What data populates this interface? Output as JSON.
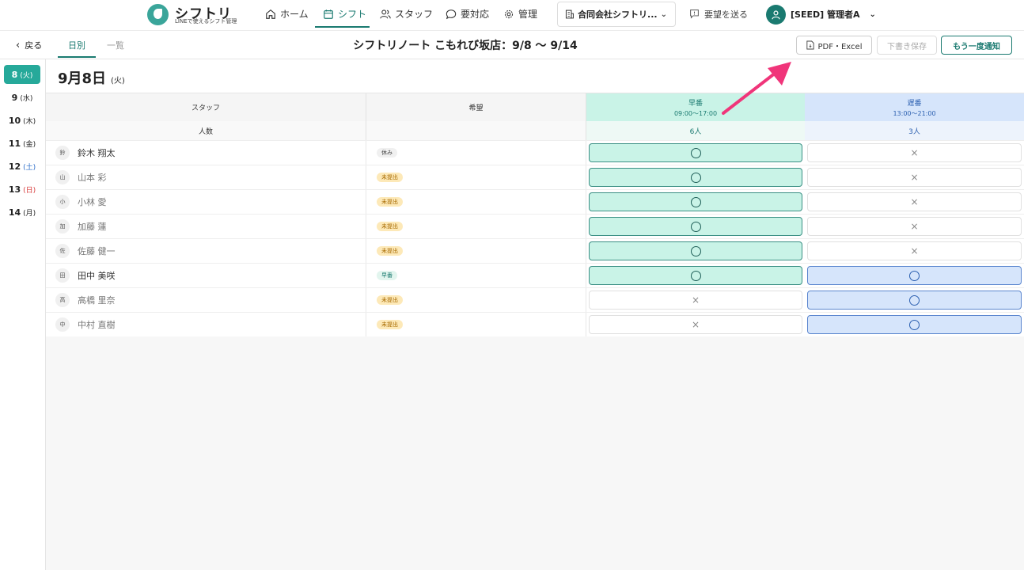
{
  "brand": {
    "name": "シフトリ",
    "tagline": "LINEで使えるシフト管理"
  },
  "nav": {
    "items": [
      {
        "label": "ホーム",
        "icon": "home-icon"
      },
      {
        "label": "シフト",
        "icon": "calendar-icon",
        "active": true
      },
      {
        "label": "スタッフ",
        "icon": "users-icon"
      },
      {
        "label": "要対応",
        "icon": "chat-icon"
      },
      {
        "label": "管理",
        "icon": "gear-icon"
      }
    ],
    "company": "合同会社シフトリ...",
    "feedback": "要望を送る",
    "user": "[SEED] 管理者A"
  },
  "subbar": {
    "back": "戻る",
    "tabs": [
      {
        "label": "日別",
        "active": true
      },
      {
        "label": "一覧",
        "active": false
      }
    ],
    "title": "シフトリノート こもれび坂店：9/8 〜 9/14",
    "pdf_button": "PDF・Excel",
    "draft_button": "下書き保存",
    "notify_button": "もう一度通知"
  },
  "days": [
    {
      "num": "8",
      "wk": "(火)",
      "active": true
    },
    {
      "num": "9",
      "wk": "(水)"
    },
    {
      "num": "10",
      "wk": "(木)"
    },
    {
      "num": "11",
      "wk": "(金)"
    },
    {
      "num": "12",
      "wk": "(土)",
      "type": "sat"
    },
    {
      "num": "13",
      "wk": "(日)",
      "type": "sun"
    },
    {
      "num": "14",
      "wk": "(月)"
    }
  ],
  "date_header": {
    "date": "9月8日",
    "weekday": "(火)"
  },
  "table": {
    "col_staff": "スタッフ",
    "col_wish": "希望",
    "count_label": "人数",
    "shifts": [
      {
        "name": "早番",
        "time": "09:00〜17:00",
        "count": "6人"
      },
      {
        "name": "遅番",
        "time": "13:00〜21:00",
        "count": "3人"
      }
    ],
    "rows": [
      {
        "initial": "鈴",
        "name": "鈴木 翔太",
        "wish": "休み",
        "wish_type": "off",
        "early": true,
        "late": false,
        "dim": false
      },
      {
        "initial": "山",
        "name": "山本 彩",
        "wish": "未提出",
        "wish_type": "unsub",
        "early": true,
        "late": false,
        "dim": true
      },
      {
        "initial": "小",
        "name": "小林 愛",
        "wish": "未提出",
        "wish_type": "unsub",
        "early": true,
        "late": false,
        "dim": true
      },
      {
        "initial": "加",
        "name": "加藤 蓮",
        "wish": "未提出",
        "wish_type": "unsub",
        "early": true,
        "late": false,
        "dim": true
      },
      {
        "initial": "佐",
        "name": "佐藤 健一",
        "wish": "未提出",
        "wish_type": "unsub",
        "early": true,
        "late": false,
        "dim": true
      },
      {
        "initial": "田",
        "name": "田中 美咲",
        "wish": "早番",
        "wish_type": "early",
        "early": true,
        "late": true,
        "dim": false
      },
      {
        "initial": "高",
        "name": "高橋 里奈",
        "wish": "未提出",
        "wish_type": "unsub",
        "early": false,
        "late": true,
        "dim": true
      },
      {
        "initial": "中",
        "name": "中村 直樹",
        "wish": "未提出",
        "wish_type": "unsub",
        "early": false,
        "late": true,
        "dim": true
      }
    ]
  },
  "colors": {
    "accent": "#1a7a70",
    "early_bg": "#c9f3e7",
    "late_bg": "#d6e5fb",
    "arrow": "#f0357a"
  }
}
